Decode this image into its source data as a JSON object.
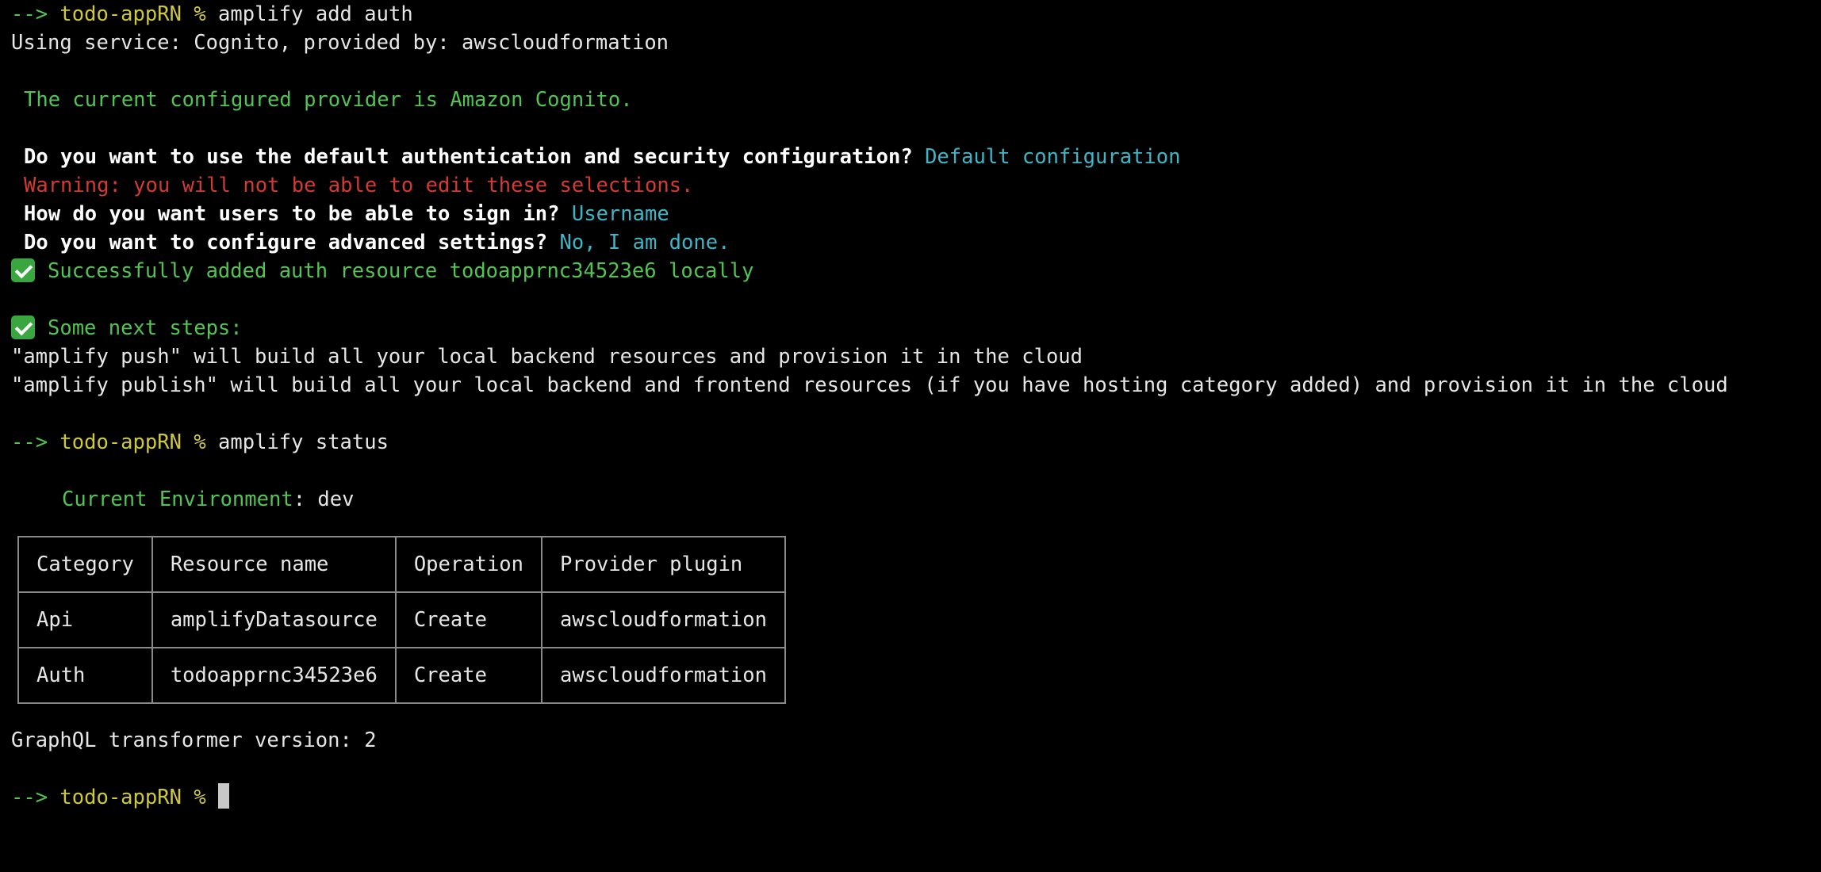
{
  "prompt": {
    "arrow": "-->",
    "dir": "todo-appRN",
    "symbol": "%"
  },
  "command1": "amplify add auth",
  "service_line": "Using service: Cognito, provided by: awscloudformation",
  "provider_line": "The current configured provider is Amazon Cognito.",
  "q1": {
    "question": "Do you want to use the default authentication and security configuration?",
    "answer": "Default configuration"
  },
  "warning": "Warning: you will not be able to edit these selections.",
  "q2": {
    "question": "How do you want users to be able to sign in?",
    "answer": "Username"
  },
  "q3": {
    "question": "Do you want to configure advanced settings?",
    "answer": "No, I am done."
  },
  "success_line": "Successfully added auth resource todoapprnc34523e6 locally",
  "next_steps_title": "Some next steps:",
  "next_step_1": "\"amplify push\" will build all your local backend resources and provision it in the cloud",
  "next_step_2": "\"amplify publish\" will build all your local backend and frontend resources (if you have hosting category added) and provision it in the cloud",
  "command2": "amplify status",
  "env": {
    "label": "Current Environment",
    "value": ": dev"
  },
  "table": {
    "headers": [
      "Category",
      "Resource name",
      "Operation",
      "Provider plugin"
    ],
    "rows": [
      [
        "Api",
        "amplifyDatasource",
        "Create",
        "awscloudformation"
      ],
      [
        "Auth",
        "todoapprnc34523e6",
        "Create",
        "awscloudformation"
      ]
    ]
  },
  "transformer_line": "GraphQL transformer version: 2",
  "icons": {
    "check": "check-mark-button-icon"
  },
  "colors": {
    "background": "#000000",
    "prompt_arrow": "#52c452",
    "prompt_dir": "#cfc83c",
    "success_green": "#52c452",
    "warning_red": "#d33a33",
    "answer_cyan": "#3fb6c8"
  }
}
